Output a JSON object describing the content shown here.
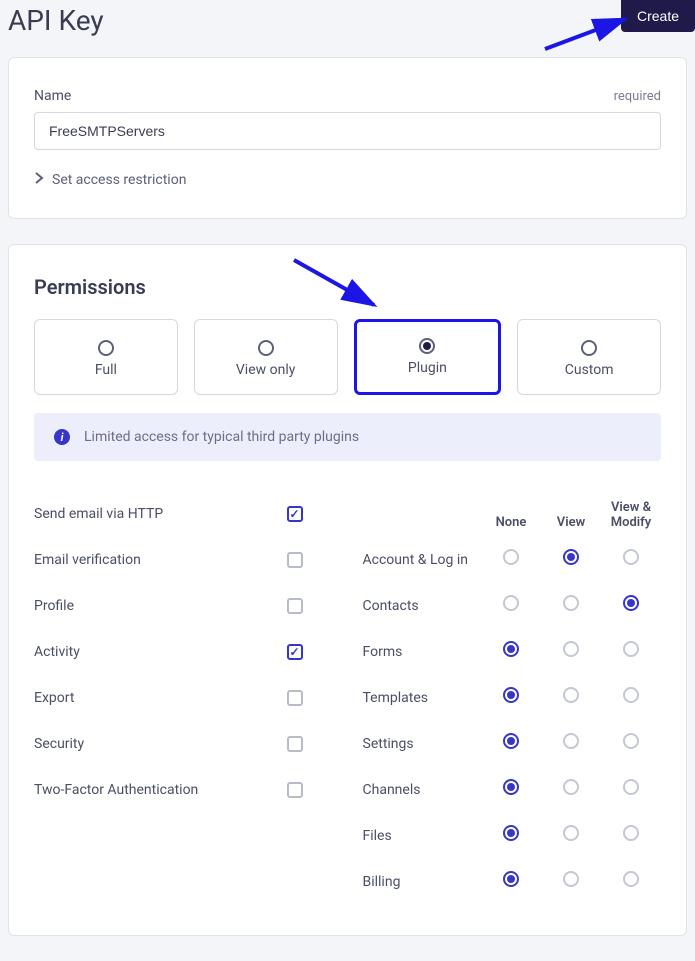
{
  "page": {
    "title": "API Key",
    "create_label": "Create"
  },
  "name_field": {
    "label": "Name",
    "required_text": "required",
    "value": "FreeSMTPServers"
  },
  "access_restriction": {
    "label": "Set access restriction"
  },
  "permissions": {
    "title": "Permissions",
    "tabs": [
      {
        "label": "Full",
        "selected": false
      },
      {
        "label": "View only",
        "selected": false
      },
      {
        "label": "Plugin",
        "selected": true
      },
      {
        "label": "Custom",
        "selected": false
      }
    ],
    "info_text": "Limited access for typical third party plugins",
    "left_items": [
      {
        "label": "Send email via HTTP",
        "checked": true
      },
      {
        "label": "Email verification",
        "checked": false
      },
      {
        "label": "Profile",
        "checked": false
      },
      {
        "label": "Activity",
        "checked": true
      },
      {
        "label": "Export",
        "checked": false
      },
      {
        "label": "Security",
        "checked": false
      },
      {
        "label": "Two-Factor Authentication",
        "checked": false
      }
    ],
    "right_headers": {
      "none": "None",
      "view": "View",
      "view_modify": "View & Modify"
    },
    "right_items": [
      {
        "label": "Account & Log in",
        "value": "view"
      },
      {
        "label": "Contacts",
        "value": "view_modify"
      },
      {
        "label": "Forms",
        "value": "none"
      },
      {
        "label": "Templates",
        "value": "none"
      },
      {
        "label": "Settings",
        "value": "none"
      },
      {
        "label": "Channels",
        "value": "none"
      },
      {
        "label": "Files",
        "value": "none"
      },
      {
        "label": "Billing",
        "value": "none"
      }
    ]
  }
}
